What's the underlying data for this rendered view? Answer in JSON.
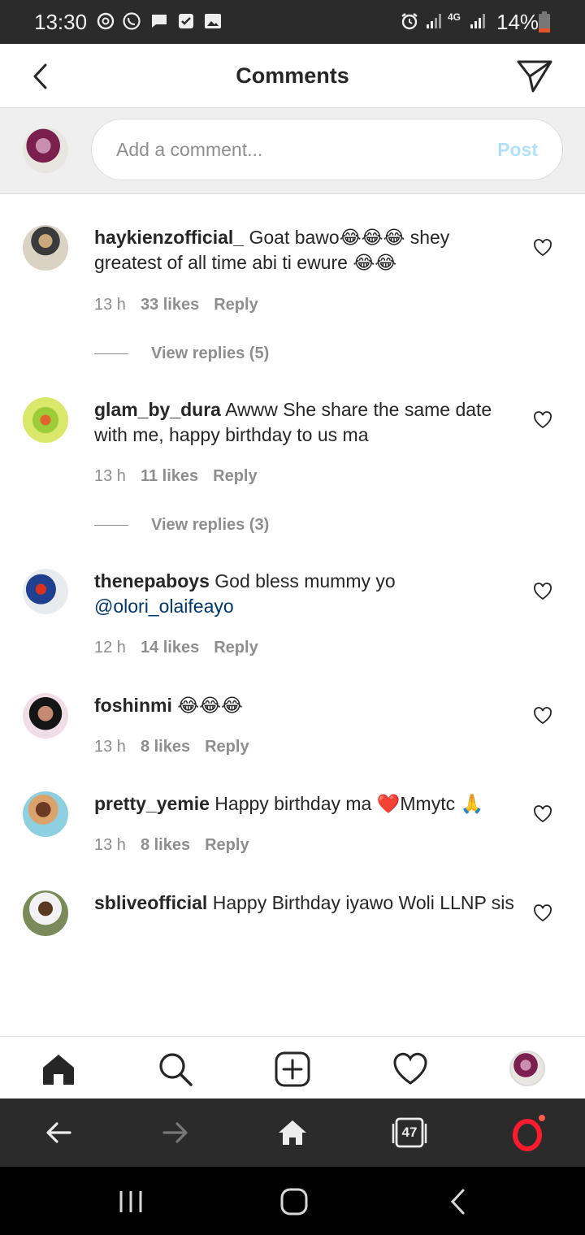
{
  "status_bar": {
    "time": "13:30",
    "battery": "14%",
    "network": "4G"
  },
  "header": {
    "title": "Comments"
  },
  "compose": {
    "placeholder": "Add a comment...",
    "post_label": "Post"
  },
  "comments": [
    {
      "username": "haykienzofficial_",
      "text": " Goat bawo😂😂😂 shey greatest of all time abi ti ewure 😂😂",
      "time": "13 h",
      "likes": "33 likes",
      "reply": "Reply",
      "view_replies": "View replies (5)"
    },
    {
      "username": "glam_by_dura",
      "text": " Awww She share the same date with me, happy birthday to us ma",
      "time": "13 h",
      "likes": "11 likes",
      "reply": "Reply",
      "view_replies": "View replies (3)"
    },
    {
      "username": "thenepaboys",
      "text": " God bless mummy yo ",
      "mention": "@olori_olaifeayo",
      "time": "12 h",
      "likes": "14 likes",
      "reply": "Reply"
    },
    {
      "username": "foshinmi",
      "text": " 😂😂😂",
      "time": "13 h",
      "likes": "8 likes",
      "reply": "Reply"
    },
    {
      "username": "pretty_yemie",
      "text": " Happy birthday ma ❤️Mmytc 🙏",
      "time": "13 h",
      "likes": "8 likes",
      "reply": "Reply"
    },
    {
      "username": "sbliveofficial",
      "text": " Happy Birthday iyawo Woli LLNP sis"
    }
  ],
  "browser_bar": {
    "tabs_count": "47"
  },
  "colors": {
    "accent_post_disabled": "#b2dffc",
    "mention": "#00376b",
    "muted": "#8e8e8e",
    "text": "#262626",
    "opera_red": "#ff1b2d"
  }
}
